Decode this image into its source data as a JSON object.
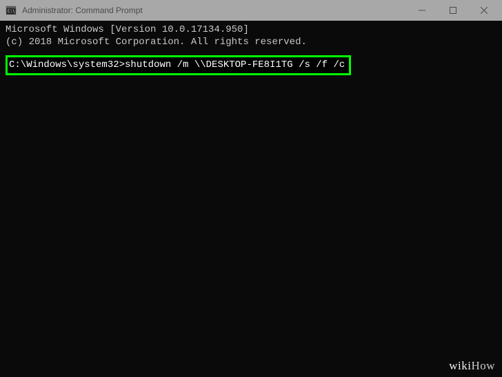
{
  "titlebar": {
    "title": "Administrator: Command Prompt"
  },
  "terminal": {
    "line1": "Microsoft Windows [Version 10.0.17134.950]",
    "line2": "(c) 2018 Microsoft Corporation. All rights reserved.",
    "prompt": "C:\\Windows\\system32>",
    "command": "shutdown /m \\\\DESKTOP-FE8I1TG /s /f /c"
  },
  "watermark": {
    "part1": "wiki",
    "part2": "How"
  }
}
